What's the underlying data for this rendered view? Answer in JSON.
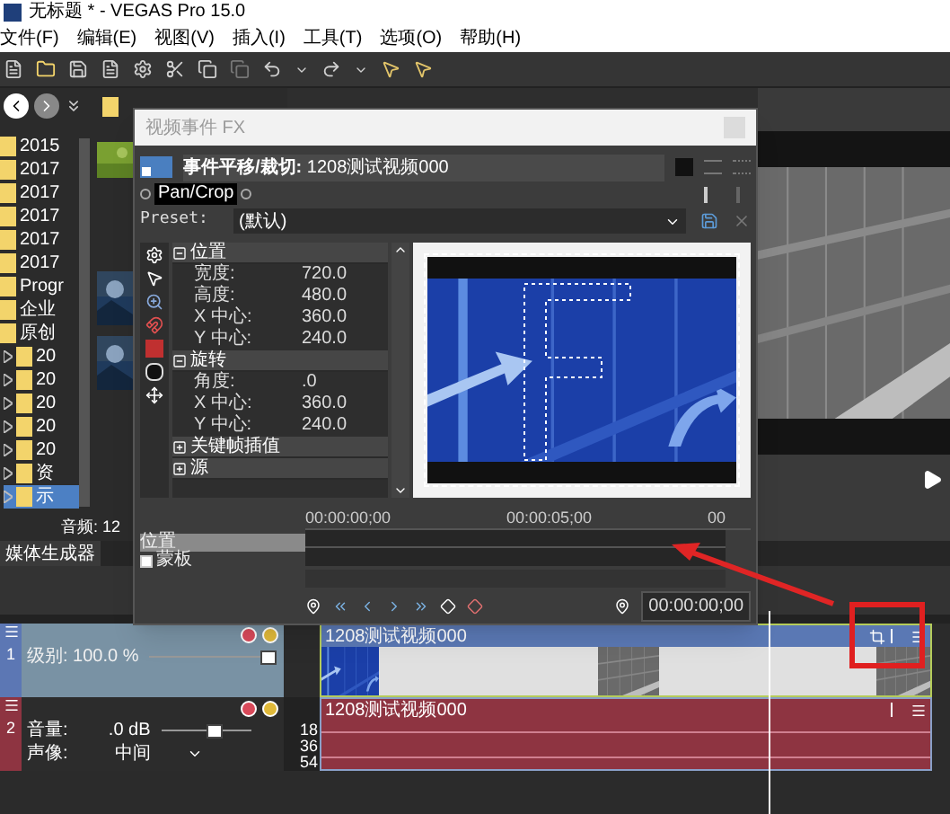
{
  "window": {
    "title": "无标题 * - VEGAS Pro 15.0"
  },
  "menu": [
    "文件(F)",
    "编辑(E)",
    "视图(V)",
    "插入(I)",
    "工具(T)",
    "选项(O)",
    "帮助(H)"
  ],
  "explorer": {
    "tree": [
      {
        "label": "2015"
      },
      {
        "label": "2017"
      },
      {
        "label": "2017"
      },
      {
        "label": "2017"
      },
      {
        "label": "2017"
      },
      {
        "label": "2017"
      },
      {
        "label": "Progr"
      },
      {
        "label": "企业"
      },
      {
        "label": "原创",
        "children": [
          {
            "label": "20",
            "selected": false
          },
          {
            "label": "20",
            "selected": false
          },
          {
            "label": "20",
            "selected": false
          },
          {
            "label": "20",
            "selected": false
          },
          {
            "label": "20",
            "selected": false
          },
          {
            "label": "资",
            "selected": false
          },
          {
            "label": "示",
            "selected": true
          }
        ]
      }
    ],
    "status": "音频: 12"
  },
  "tabs": [
    {
      "label": "媒体生成器",
      "selected": true
    }
  ],
  "fx_dialog": {
    "title": "视频事件 FX",
    "chain": "**事件平移/裁切:** 1208测试视频000",
    "plugin": "Pan/Crop",
    "preset_label": "Preset:",
    "preset_value": "(默认)",
    "groups": [
      {
        "label": "位置",
        "expanded": true,
        "props": [
          {
            "name": "宽度:",
            "value": "720.0"
          },
          {
            "name": "高度:",
            "value": "480.0"
          },
          {
            "name": "X 中心:",
            "value": "360.0"
          },
          {
            "name": "Y 中心:",
            "value": "240.0"
          }
        ]
      },
      {
        "label": "旋转",
        "expanded": true,
        "props": [
          {
            "name": "角度:",
            "value": ".0"
          },
          {
            "name": "X 中心:",
            "value": "360.0"
          },
          {
            "name": "Y 中心:",
            "value": "240.0"
          }
        ]
      },
      {
        "label": "关键帧插值",
        "expanded": false
      },
      {
        "label": "源",
        "expanded": false
      }
    ],
    "ruler": [
      "00:00:00;00",
      "00:00:05;00",
      "00"
    ],
    "tracks": [
      {
        "kind": "plain",
        "label": "位置",
        "selected": true
      },
      {
        "kind": "checkbox",
        "label": "蒙板",
        "selected": false,
        "checked": false
      }
    ],
    "time": "00:00:00;00"
  },
  "timeline": {
    "tracks": [
      {
        "kind": "video",
        "number": "1",
        "params": [
          {
            "label": "级别: 100.0 %",
            "level": 0.95
          }
        ],
        "event": "1208测试视频000"
      },
      {
        "kind": "audio",
        "number": "2",
        "params": [
          {
            "label": "音量:",
            "value": ".0 dB",
            "level": 0.6
          },
          {
            "label": "声像:",
            "value": "中间"
          }
        ],
        "event": "1208测试视频000",
        "meter": [
          "18",
          "36",
          "54"
        ]
      }
    ]
  }
}
